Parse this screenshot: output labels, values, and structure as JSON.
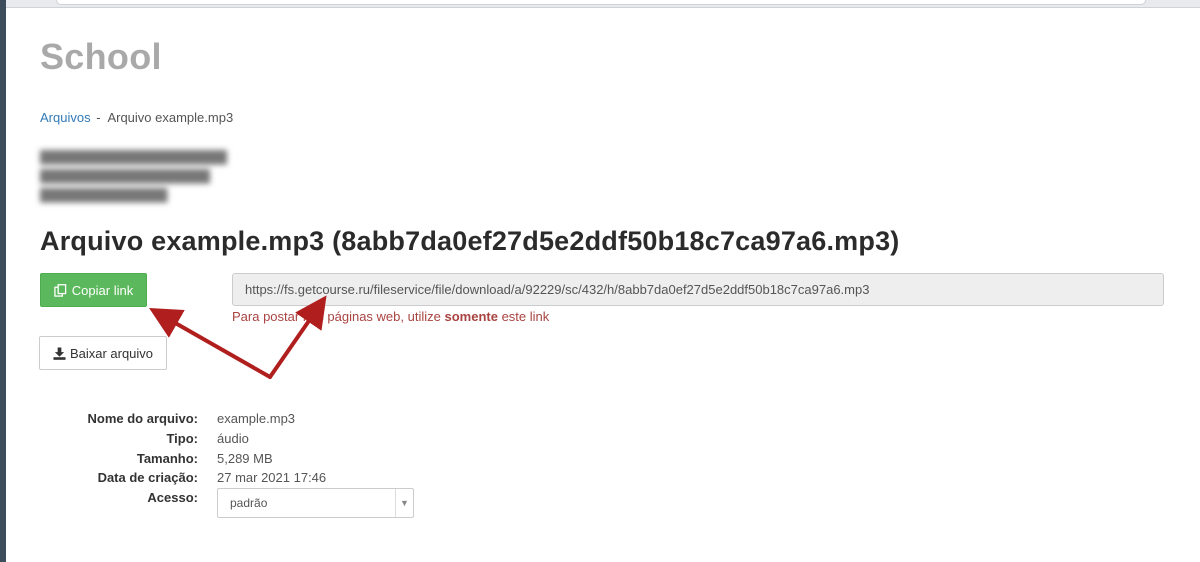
{
  "site": {
    "title": "School"
  },
  "breadcrumb": {
    "parent": "Arquivos",
    "separator": "-",
    "current": "Arquivo example.mp3"
  },
  "blurred_lines": [
    "",
    "",
    ""
  ],
  "heading": "Arquivo example.mp3 (8abb7da0ef27d5e2ddf50b18c7ca97a6.mp3)",
  "actions": {
    "copy_label": "Copiar link",
    "download_label": "Baixar arquivo"
  },
  "link": {
    "url": "https://fs.getcourse.ru/fileservice/file/download/a/92229/sc/432/h/8abb7da0ef27d5e2ddf50b18c7ca97a6.mp3",
    "hint_before": "Para postar nas páginas web, utilize",
    "hint_bold": "somente",
    "hint_after": "este link"
  },
  "details": {
    "filename_label": "Nome do arquivo:",
    "filename": "example.mp3",
    "type_label": "Tipo:",
    "type": "áudio",
    "size_label": "Tamanho:",
    "size": "5,289 MB",
    "created_label": "Data de criação:",
    "created": "27 mar 2021 17:46",
    "access_label": "Acesso:",
    "access_selected": "padrão"
  },
  "icons": {
    "copy": "copy-icon",
    "download": "download-icon",
    "caret": "caret-down-icon"
  },
  "colors": {
    "success": "#5cb85c",
    "link": "#337ab7",
    "danger": "#a94442",
    "annotation": "#b01e1e"
  }
}
